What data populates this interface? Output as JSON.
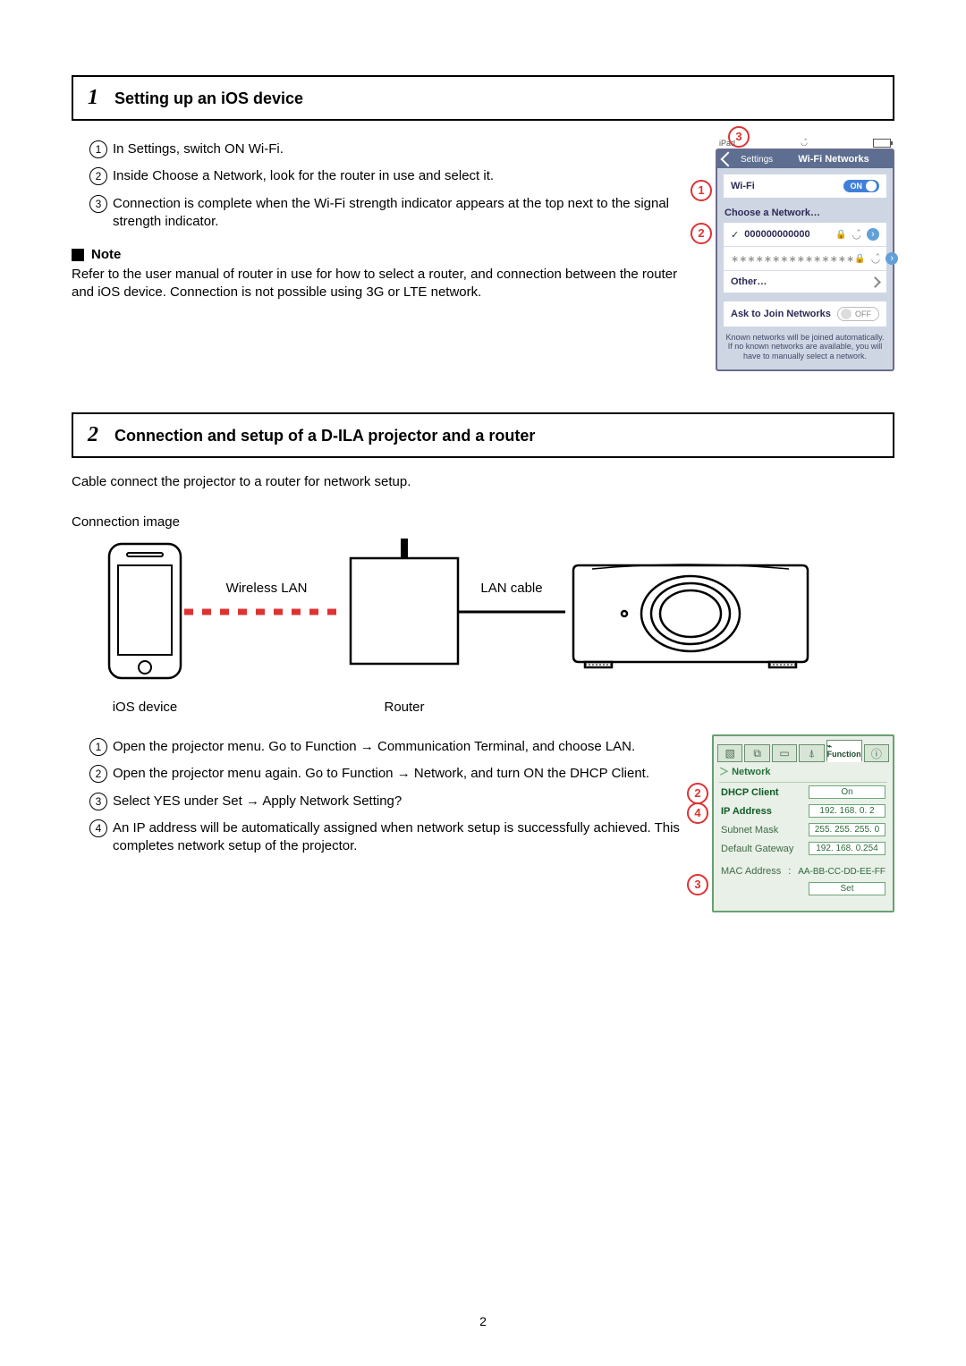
{
  "step1": {
    "num": "1",
    "title": "Setting up an iOS device",
    "items": [
      "In Settings, switch ON Wi-Fi.",
      "Inside Choose a Network, look for the router in use and select it.",
      "Connection is complete when the Wi-Fi strength indicator appears at the top next to the signal strength indicator."
    ],
    "note_label": "Note",
    "note_body": "Refer to the user manual of router in use for how to select a router, and connection between the router and iOS device. Connection is not possible using 3G or LTE network."
  },
  "ios_shot": {
    "device": "iPad",
    "back": "Settings",
    "title": "Wi-Fi Networks",
    "wifi_label": "Wi-Fi",
    "wifi_state": "ON",
    "choose": "Choose a Network…",
    "net1": "000000000000",
    "net2": "∗∗∗∗∗∗∗∗∗∗∗∗∗∗∗",
    "other": "Other…",
    "ask": "Ask to Join Networks",
    "ask_state": "OFF",
    "hint": "Known networks will be joined automatically. If no known networks are available, you will have to manually select a network."
  },
  "step2": {
    "num": "2",
    "title": "Connection and setup of a D-ILA projector and a router",
    "lead": "Cable connect the projector to a router for network setup.",
    "connimg_label": "Connection image",
    "wireless": "Wireless LAN",
    "lan": "LAN cable",
    "ios_dev": "iOS device",
    "router": "Router",
    "items": [
      "Open the projector menu. Go to Function → Communication Terminal, and choose LAN.",
      "Open the projector menu again. Go to Function → Network, and turn ON the DHCP Client.",
      "Select YES under Set → Apply Network Setting?",
      "An IP address will be automatically assigned when network setup is successfully achieved. This completes network setup of the projector."
    ]
  },
  "proj_shot": {
    "func_tab": "Function",
    "section": "Network",
    "rows": {
      "dhcp": "DHCP Client",
      "dhcp_v": "On",
      "ip": "IP Address",
      "ip_v": "192. 168.   0.   2",
      "mask": "Subnet Mask",
      "mask_v": "255. 255. 255.   0",
      "gw": "Default Gateway",
      "gw_v": "192. 168.   0.254",
      "mac": "MAC Address",
      "mac_v": "AA-BB-CC-DD-EE-FF",
      "set": "Set"
    }
  },
  "page_number": "2"
}
